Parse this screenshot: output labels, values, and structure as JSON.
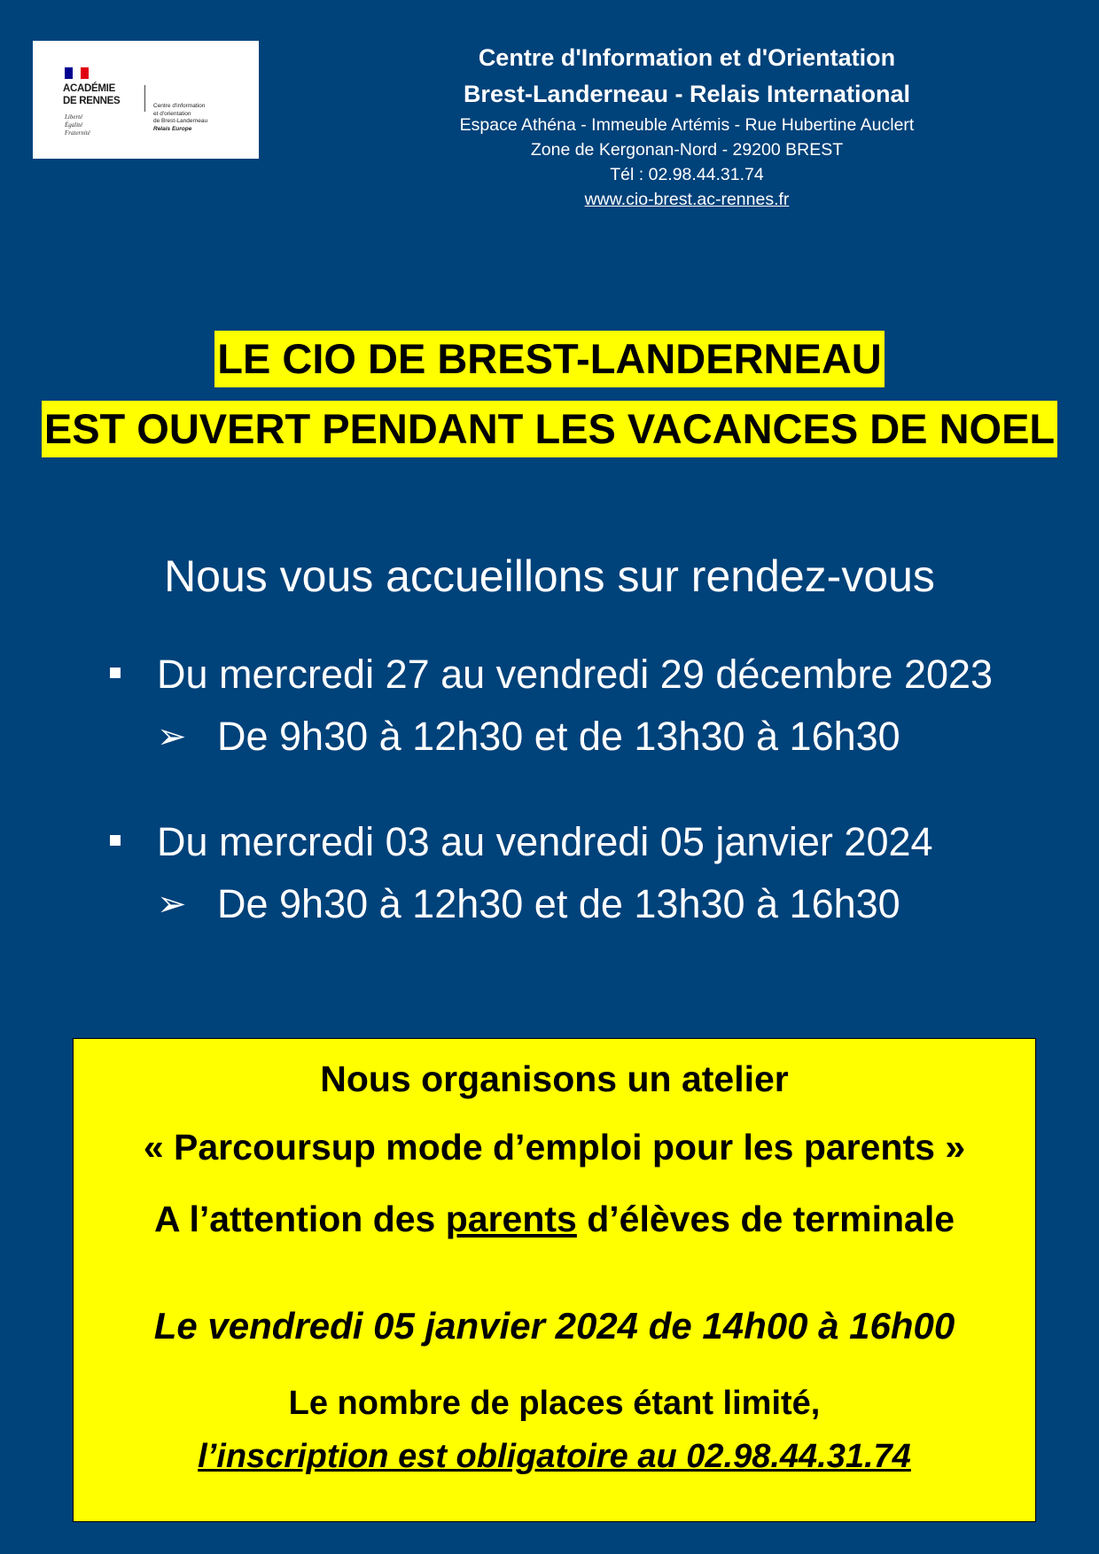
{
  "logo": {
    "colors": {
      "blue": "#000091",
      "white": "#ffffff",
      "red": "#e1000f"
    },
    "line1": "ACADÉMIE",
    "line2": "DE RENNES",
    "motto": [
      "Liberté",
      "Égalité",
      "Fraternité"
    ],
    "sub": [
      "Centre d'information",
      "et d'orientation",
      "de Brest-Landerneau",
      "Relais Europe"
    ]
  },
  "header": {
    "title1": "Centre d'Information et d'Orientation",
    "title2": "Brest-Landerneau - Relais International",
    "address1": "Espace Athéna - Immeuble Artémis - Rue Hubertine Auclert",
    "address2": "Zone de Kergonan-Nord - 29200 BREST",
    "phone": "Tél : 02.98.44.31.74",
    "url": "www.cio-brest.ac-rennes.fr"
  },
  "headline": {
    "line1": "LE CIO DE BREST-LANDERNEAU",
    "line2": "EST OUVERT PENDANT LES VACANCES DE NOEL"
  },
  "welcome": "Nous vous accueillons sur rendez-vous",
  "schedule": [
    {
      "period": "Du mercredi 27 au vendredi 29 décembre 2023",
      "hours": "De 9h30 à 12h30 et de 13h30 à 16h30"
    },
    {
      "period": "Du mercredi 03 au vendredi 05 janvier 2024",
      "hours": "De 9h30 à 12h30 et de 13h30 à 16h30"
    }
  ],
  "workshop": {
    "intro": "Nous organisons un atelier",
    "title": "« Parcoursup mode d’emploi pour les parents »",
    "audience_pre": "A l’attention des ",
    "audience_emph": "parents",
    "audience_post": " d’élèves de terminale",
    "date": "Le vendredi 05 janvier 2024 de 14h00 à 16h00",
    "limit": "Le nombre de places étant limité,",
    "registration": "l’inscription est obligatoire au 02.98.44.31.74"
  }
}
